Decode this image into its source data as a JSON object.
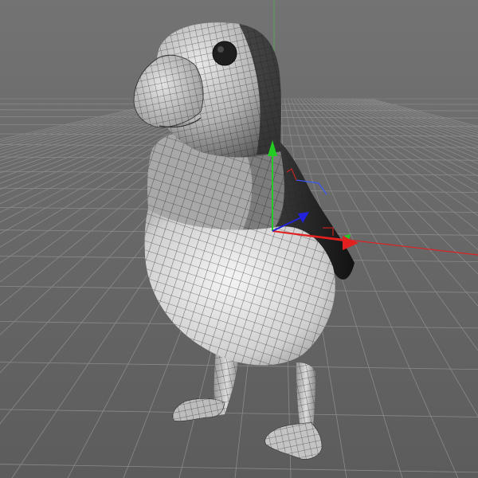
{
  "viewport": {
    "background_top": "#6f6f6f",
    "background_bottom": "#5f5f5f",
    "grid_color": "#8a8a8a",
    "horizon_color": "#7a7a7a",
    "world_axis_y_color": "#3fae3f",
    "world_axis_x_color": "#c83a3a"
  },
  "model": {
    "name": "puffin",
    "display_mode": "wireframe-on-shaded",
    "body_dark_color": "#3a3a3a",
    "body_light_color": "#d6d6d6",
    "wire_color": "#222222",
    "eye_color": "#1a1a1a"
  },
  "gizmo": {
    "type": "move-manipulator",
    "x_axis_color": "#e02020",
    "y_axis_color": "#22cc22",
    "z_axis_color": "#2222dd",
    "rotation_hint_color": "#3050ff"
  }
}
